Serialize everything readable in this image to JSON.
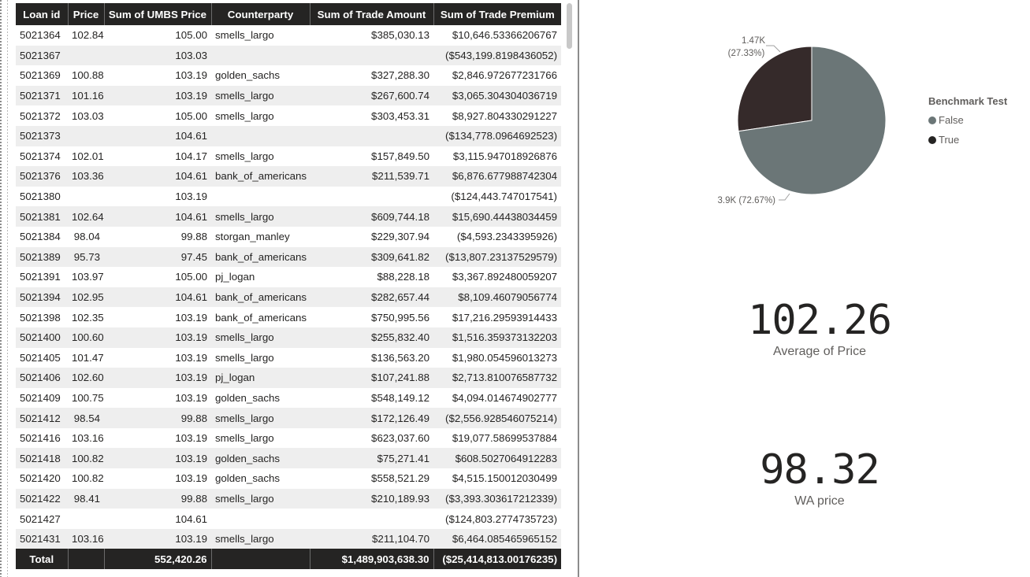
{
  "table": {
    "headers": [
      "Loan id",
      "Price",
      "Sum of UMBS Price",
      "Counterparty",
      "Sum of Trade Amount",
      "Sum of Trade Premium"
    ],
    "rows": [
      [
        "5021364",
        "102.84",
        "105.00",
        "smells_largo",
        "$385,030.13",
        "$10,646.53366206767"
      ],
      [
        "5021367",
        "",
        "103.03",
        "",
        "",
        "($543,199.8198436052)"
      ],
      [
        "5021369",
        "100.88",
        "103.19",
        "golden_sachs",
        "$327,288.30",
        "$2,846.972677231766"
      ],
      [
        "5021371",
        "101.16",
        "103.19",
        "smells_largo",
        "$267,600.74",
        "$3,065.304304036719"
      ],
      [
        "5021372",
        "103.03",
        "105.00",
        "smells_largo",
        "$303,453.31",
        "$8,927.804330291227"
      ],
      [
        "5021373",
        "",
        "104.61",
        "",
        "",
        "($134,778.0964692523)"
      ],
      [
        "5021374",
        "102.01",
        "104.17",
        "smells_largo",
        "$157,849.50",
        "$3,115.947018926876"
      ],
      [
        "5021376",
        "103.36",
        "104.61",
        "bank_of_americans",
        "$211,539.71",
        "$6,876.677988742304"
      ],
      [
        "5021380",
        "",
        "103.19",
        "",
        "",
        "($124,443.747017541)"
      ],
      [
        "5021381",
        "102.64",
        "104.61",
        "smells_largo",
        "$609,744.18",
        "$15,690.44438034459"
      ],
      [
        "5021384",
        "98.04",
        "99.88",
        "storgan_manley",
        "$229,307.94",
        "($4,593.2343395926)"
      ],
      [
        "5021389",
        "95.73",
        "97.45",
        "bank_of_americans",
        "$309,641.82",
        "($13,807.23137529579)"
      ],
      [
        "5021391",
        "103.97",
        "105.00",
        "pj_logan",
        "$88,228.18",
        "$3,367.892480059207"
      ],
      [
        "5021394",
        "102.95",
        "104.61",
        "bank_of_americans",
        "$282,657.44",
        "$8,109.46079056774"
      ],
      [
        "5021398",
        "102.35",
        "103.19",
        "bank_of_americans",
        "$750,995.56",
        "$17,216.29593914433"
      ],
      [
        "5021400",
        "100.60",
        "103.19",
        "smells_largo",
        "$255,832.40",
        "$1,516.359373132203"
      ],
      [
        "5021405",
        "101.47",
        "103.19",
        "smells_largo",
        "$136,563.20",
        "$1,980.054596013273"
      ],
      [
        "5021406",
        "102.60",
        "103.19",
        "pj_logan",
        "$107,241.88",
        "$2,713.810076587732"
      ],
      [
        "5021409",
        "100.75",
        "103.19",
        "golden_sachs",
        "$548,149.12",
        "$4,094.014674902777"
      ],
      [
        "5021412",
        "98.54",
        "99.88",
        "smells_largo",
        "$172,126.49",
        "($2,556.928546075214)"
      ],
      [
        "5021416",
        "103.16",
        "103.19",
        "smells_largo",
        "$623,037.60",
        "$19,077.58699537884"
      ],
      [
        "5021418",
        "100.82",
        "103.19",
        "golden_sachs",
        "$75,271.41",
        "$608.5027064912283"
      ],
      [
        "5021420",
        "100.82",
        "103.19",
        "golden_sachs",
        "$558,521.29",
        "$4,515.150012030499"
      ],
      [
        "5021422",
        "98.41",
        "99.88",
        "smells_largo",
        "$210,189.93",
        "($3,393.303617212339)"
      ],
      [
        "5021427",
        "",
        "104.61",
        "",
        "",
        "($124,803.2774735723)"
      ],
      [
        "5021431",
        "103.16",
        "103.19",
        "smells_largo",
        "$211,104.70",
        "$6,464.085465965152"
      ]
    ],
    "total": {
      "label": "Total",
      "price": "",
      "umbs": "552,420.26",
      "counterparty": "",
      "amount": "$1,489,903,638.30",
      "premium": "($25,414,813.00176235)"
    }
  },
  "chart_data": {
    "type": "pie",
    "title": "",
    "legend_title": "Benchmark Test",
    "legend_position": "right",
    "slices": [
      {
        "name": "False",
        "value": 3900,
        "percent": 72.67,
        "label": "3.9K (72.67%)",
        "color": "#6b7677"
      },
      {
        "name": "True",
        "value": 1470,
        "percent": 27.33,
        "label_value": "1.47K",
        "label_percent": "(27.33%)",
        "color": "#352a2a"
      }
    ]
  },
  "cards": [
    {
      "value": "102.26",
      "label": "Average of Price"
    },
    {
      "value": "98.32",
      "label": "WA price"
    }
  ],
  "colors": {
    "header_bg": "#252423",
    "row_alt": "#eeeeee",
    "false_slice": "#6b7677",
    "true_slice": "#352a2a"
  }
}
